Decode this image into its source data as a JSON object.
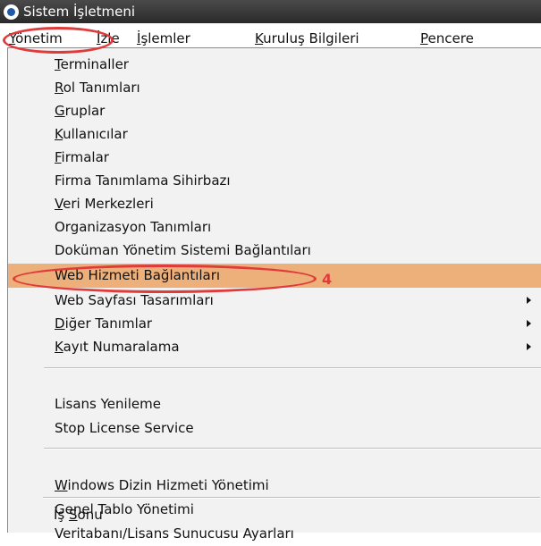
{
  "window": {
    "title": "Sistem İşletmeni"
  },
  "menubar": [
    {
      "prefix": "",
      "key": "Y",
      "rest": "önetim"
    },
    {
      "prefix": "",
      "key": "İ",
      "rest": "zle"
    },
    {
      "prefix": "",
      "key": "İ",
      "rest": "şlemler"
    },
    {
      "prefix": "",
      "key": "K",
      "rest": "uruluş Bilgileri"
    },
    {
      "prefix": "",
      "key": "P",
      "rest": "encere"
    }
  ],
  "menu": [
    {
      "prefix": "",
      "key": "T",
      "rest": "erminaller"
    },
    {
      "prefix": "",
      "key": "R",
      "rest": "ol Tanımları"
    },
    {
      "prefix": "",
      "key": "G",
      "rest": "ruplar"
    },
    {
      "prefix": "",
      "key": "K",
      "rest": "ullanıcılar"
    },
    {
      "prefix": "",
      "key": "F",
      "rest": "irmalar"
    },
    {
      "prefix": "Firma Tanımlama Sihirbazı",
      "key": "",
      "rest": ""
    },
    {
      "prefix": "",
      "key": "V",
      "rest": "eri Merkezleri"
    },
    {
      "prefix": "Organizasyon Tanımları",
      "key": "",
      "rest": ""
    },
    {
      "prefix": "Doküman Yönetim Sistemi Bağlantıları",
      "key": "",
      "rest": ""
    },
    {
      "prefix": "Web Hizmeti Bağlantıları",
      "key": "",
      "rest": ""
    },
    {
      "prefix": "Web Sayfası Tasarımları",
      "key": "",
      "rest": ""
    },
    {
      "prefix": "",
      "key": "D",
      "rest": "iğer Tanımlar"
    },
    {
      "prefix": "",
      "key": "K",
      "rest": "ayıt Numaralama"
    },
    {
      "prefix": "Lisans Yenileme",
      "key": "",
      "rest": ""
    },
    {
      "prefix": "Stop License Service",
      "key": "",
      "rest": ""
    },
    {
      "prefix": "",
      "key": "W",
      "rest": "indows Dizin Hizmeti Yönetimi"
    },
    {
      "prefix": "Genel Tablo Yönetimi",
      "key": "",
      "rest": ""
    },
    {
      "prefix": "Veritabanı/Lisans Sunucusu Ayarları",
      "key": "",
      "rest": ""
    },
    {
      "prefix": "İş ",
      "key": "S",
      "rest": "onu"
    }
  ],
  "annotation": {
    "step": "4"
  },
  "colors": {
    "highlight": "#eeb07a",
    "annotation": "#e03a3a",
    "titlebar": "#2a2a2a"
  }
}
